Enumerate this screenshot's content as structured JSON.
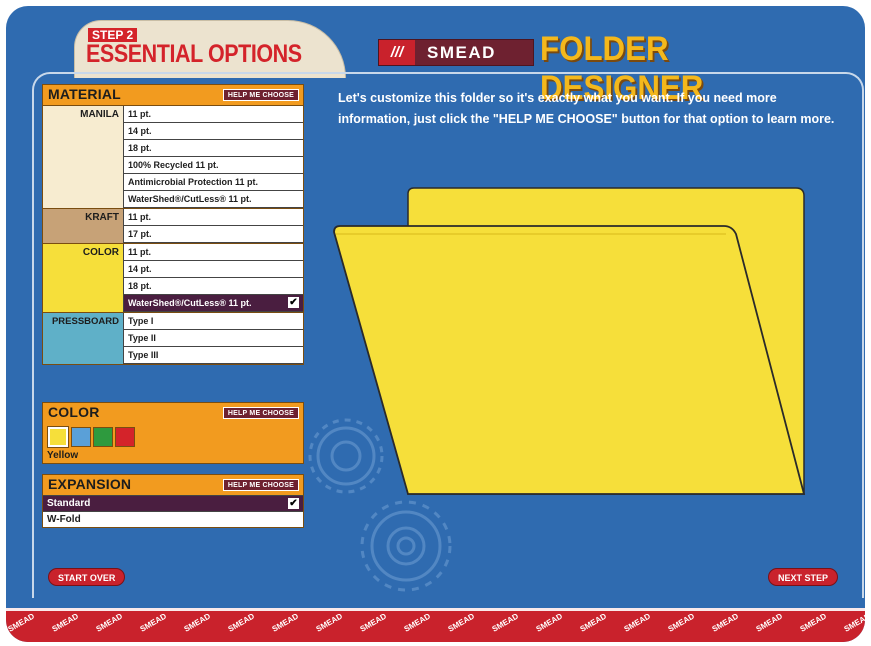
{
  "header": {
    "step_label": "STEP 2",
    "step_title": "ESSENTIAL OPTIONS",
    "brand_slashes": "///",
    "brand_name": "SMEAD",
    "app_title": "FOLDER DESIGNER"
  },
  "intro_text": "Let's customize this folder so it's exactly what you want. If you need more information, just click the \"HELP ME CHOOSE\" button for that option to learn more.",
  "material": {
    "title": "MATERIAL",
    "help_label": "HELP ME CHOOSE",
    "groups": [
      {
        "label": "MANILA",
        "options": [
          "11 pt.",
          "14 pt.",
          "18 pt.",
          "100% Recycled 11 pt.",
          "Antimicrobial Protection 11 pt.",
          "WaterShed®/CutLess® 11 pt."
        ]
      },
      {
        "label": "KRAFT",
        "options": [
          "11 pt.",
          "17 pt."
        ]
      },
      {
        "label": "COLOR",
        "options": [
          "11 pt.",
          "14 pt.",
          "18 pt.",
          "WaterShed®/CutLess® 11 pt."
        ]
      },
      {
        "label": "PRESSBOARD",
        "options": [
          "Type I",
          "Type II",
          "Type III"
        ]
      }
    ],
    "selected": "WaterShed®/CutLess® 11 pt. (COLOR)"
  },
  "color": {
    "title": "COLOR",
    "help_label": "HELP ME CHOOSE",
    "swatches": [
      "#f6df3a",
      "#5aa0d8",
      "#2e9a3e",
      "#d4232a"
    ],
    "selected_name": "Yellow"
  },
  "expansion": {
    "title": "EXPANSION",
    "help_label": "HELP ME CHOOSE",
    "options": [
      "Standard",
      "W-Fold"
    ],
    "selected": "Standard"
  },
  "buttons": {
    "start_over": "START OVER",
    "next_step": "NEXT STEP"
  },
  "colors": {
    "background_blue": "#2f6bb0",
    "folder_yellow": "#f6df3a",
    "accent_orange": "#f29b1f",
    "brand_red": "#c9222c",
    "brand_maroon": "#6e2130",
    "manila_group": "#f7ecd0",
    "kraft_group": "#c7a277",
    "color_group": "#f6df3a",
    "pressboard_group": "#5fb0c8"
  },
  "icons": {
    "check": "checkmark-icon",
    "gear": "gear-icon"
  }
}
